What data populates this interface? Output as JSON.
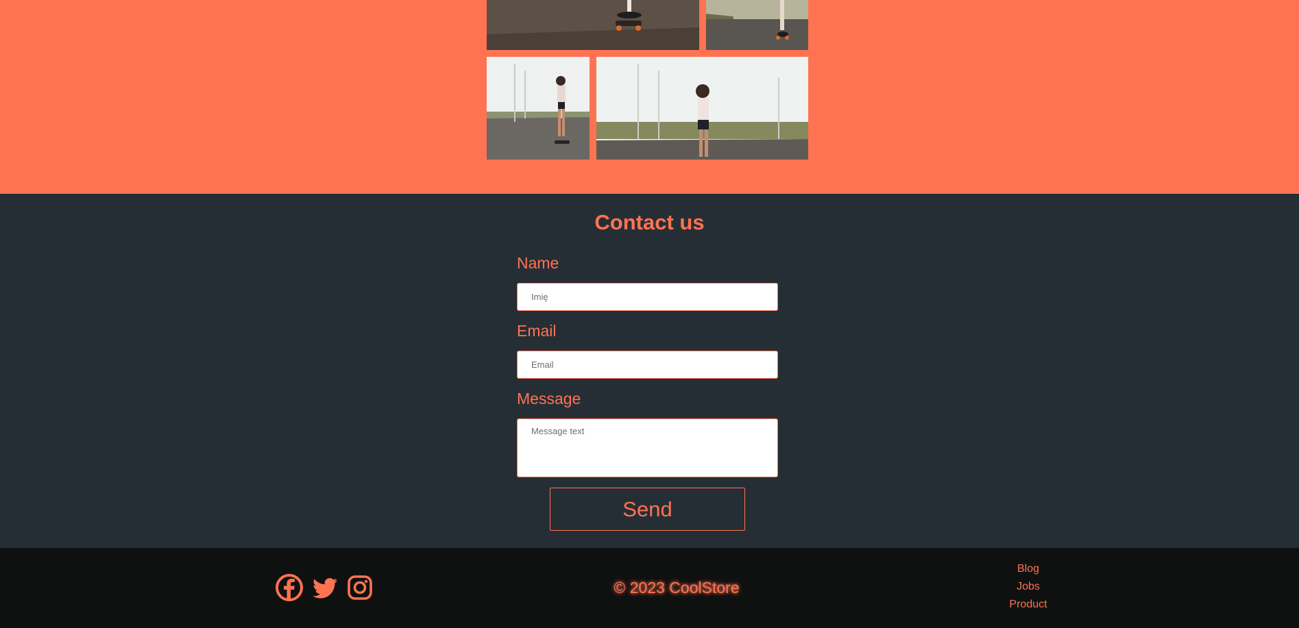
{
  "theme": {
    "accent": "#ff7352",
    "section_bg": "#262e35",
    "footer_bg": "#0f1111",
    "gallery_bg": "#ff7352"
  },
  "gallery": {
    "images": [
      {
        "name": "skater-feet-road",
        "alt": ""
      },
      {
        "name": "skater-legs-road",
        "alt": ""
      },
      {
        "name": "skater-girl-road-small",
        "alt": ""
      },
      {
        "name": "skater-girl-road-wide",
        "alt": ""
      }
    ]
  },
  "contact": {
    "title": "Contact us",
    "name_label": "Name",
    "name_placeholder": "Imię",
    "email_label": "Email",
    "email_placeholder": "Email",
    "message_label": "Message",
    "message_placeholder": "Message text",
    "send_label": "Send"
  },
  "footer": {
    "social_icons": [
      "facebook-icon",
      "twitter-icon",
      "instagram-icon"
    ],
    "copyright": "© 2023 CoolStore",
    "links": [
      "Blog",
      "Jobs",
      "Product"
    ]
  }
}
